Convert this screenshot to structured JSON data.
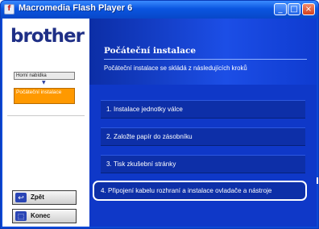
{
  "window": {
    "title": "Macromedia Flash Player 6",
    "icon_name": "flash-player-icon"
  },
  "sidebar": {
    "logo": "brother",
    "nav": {
      "home_label": "Horní nabídka",
      "current_label": "Počáteční instalace"
    },
    "buttons": {
      "back_label": "Zpět",
      "back_icon": "back-arrow-icon",
      "quit_label": "Konec",
      "quit_icon": "exit-icon"
    }
  },
  "main": {
    "title": "Počáteční instalace",
    "subtitle": "Počáteční instalace se skládá z následujících kroků",
    "steps": [
      "1. Instalace jednotky válce",
      "2. Založte papír do zásobníku",
      "3. Tisk zkušební stránky",
      "4. Připojení kabelu rozhraní a instalace ovladače a nástroje"
    ]
  },
  "colors": {
    "accent": "#ff9900",
    "panel": "#0f38c8",
    "titlebar": "#0a55e0"
  }
}
